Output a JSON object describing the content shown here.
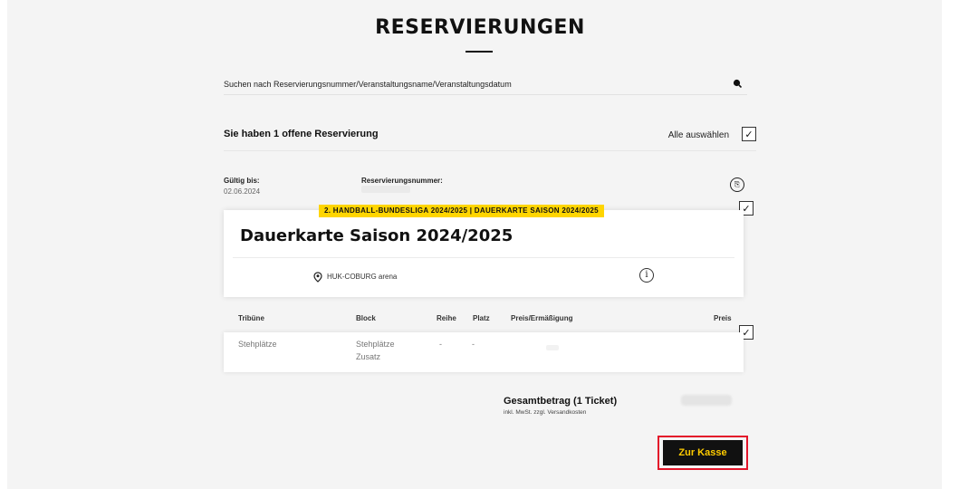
{
  "header": {
    "title": "RESERVIERUNGEN"
  },
  "search": {
    "placeholder": "Suchen nach Reservierungsnummer/Veranstaltungsname/Veranstaltungsdatum",
    "icon": "search-icon"
  },
  "summary": {
    "count_text": "Sie haben 1 offene Reservierung",
    "select_all_label": "Alle auswählen",
    "select_all_checked": "✓"
  },
  "reservation": {
    "valid_label": "Gültig bis:",
    "valid_value": "02.06.2024",
    "number_label": "Reservierungsnummer:",
    "event_checked": "✓",
    "event": {
      "tag": "2. HANDBALL-BUNDESLIGA 2024/2025 | DAUERKARTE SAISON 2024/2025",
      "name": "Dauerkarte Saison 2024/2025",
      "venue": "HUK-COBURG arena",
      "info_glyph": "i"
    },
    "table": {
      "headers": [
        "Tribüne",
        "Block",
        "Reihe",
        "Platz",
        "Preis/Ermäßigung",
        "Preis"
      ],
      "rows": [
        {
          "tribune": "Stehplätze",
          "block_line1": "Stehplätze",
          "block_line2": "Zusatz",
          "reihe": "-",
          "platz": "-",
          "checked": "✓"
        }
      ]
    },
    "total": {
      "label": "Gesamtbetrag (1 Ticket)",
      "sub": "inkl. MwSt. zzgl. Versandkosten"
    }
  },
  "checkout": {
    "label": "Zur Kasse"
  },
  "colors": {
    "accent_yellow": "#ffd500",
    "button_bg": "#111111",
    "button_text": "#ffcc00",
    "highlight_red": "#e3152a"
  }
}
